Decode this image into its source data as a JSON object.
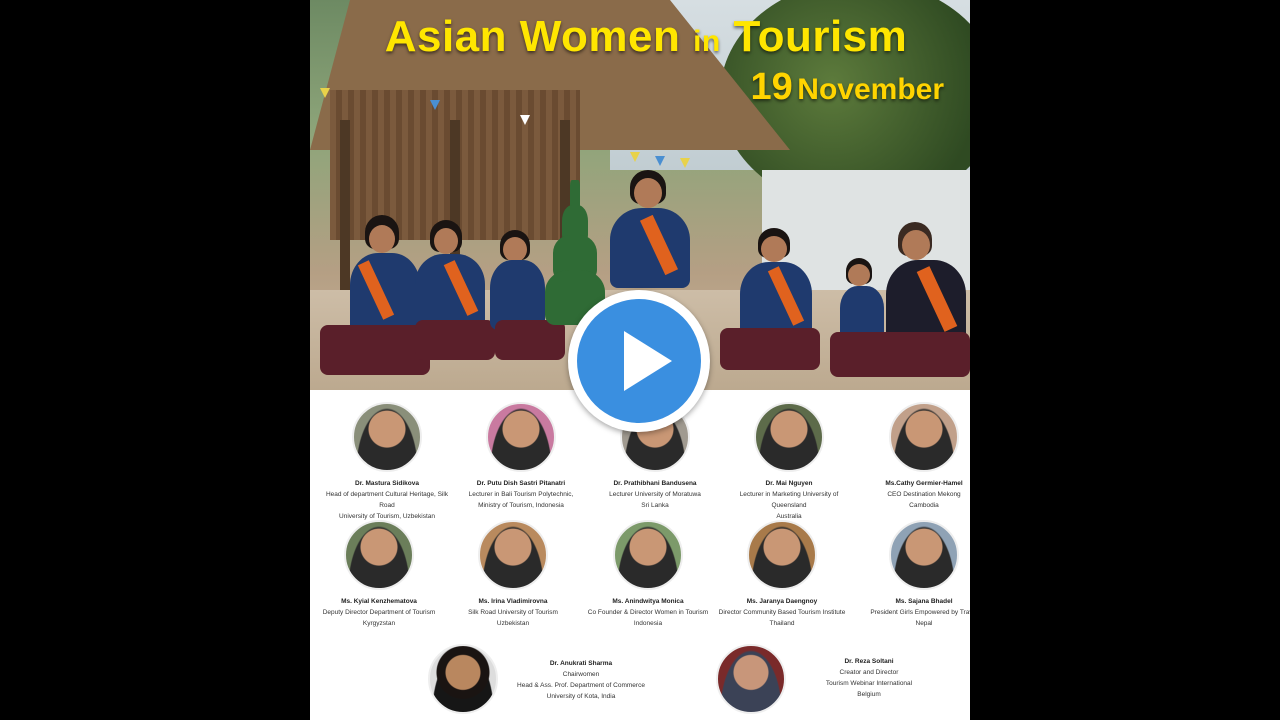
{
  "poster": {
    "title_main": "Asian Women",
    "title_in": "in",
    "title_tail": "Tourism",
    "date_day": "19",
    "date_month": "November"
  },
  "colors": {
    "title": "#ffe600",
    "play": "#3a8fe0",
    "background": "#000000"
  },
  "speakers_row1": [
    {
      "name": "Dr. Mastura Sidikova",
      "line1": "Head of department Cultural Heritage, Silk Road",
      "line2": "University of Tourism, Uzbekistan"
    },
    {
      "name": "Dr. Putu Dish Sastri Pitanatri",
      "line1": "Lecturer in Bali Tourism Polytechnic,",
      "line2": "Ministry of Tourism, Indonesia"
    },
    {
      "name": "Dr. Prathibhani Bandusena",
      "line1": "Lecturer University of Moratuwa",
      "line2": "Sri Lanka"
    },
    {
      "name": "Dr. Mai Nguyen",
      "line1": "Lecturer in Marketing University of Queensland",
      "line2": "Australia"
    },
    {
      "name": "Ms.Cathy Germier-Hamel",
      "line1": "CEO Destination Mekong",
      "line2": "Cambodia"
    }
  ],
  "speakers_row2": [
    {
      "name": "Ms. Kyial Kenzhematova",
      "line1": "Deputy Director Department of Tourism",
      "line2": "Kyrgyzstan"
    },
    {
      "name": "Ms. Irina Vladimirovna",
      "line1": "Silk Road University of Tourism",
      "line2": "Uzbekistan"
    },
    {
      "name": "Ms. Anindwitya Monica",
      "line1": "Co Founder & Director Women in Tourism",
      "line2": "Indonesia"
    },
    {
      "name": "Ms. Jaranya Daengnoy",
      "line1": "Director Community Based Tourism Institute",
      "line2": "Thailand"
    },
    {
      "name": "Ms. Sajana Bhadel",
      "line1": "President Girls Empowered by Travel",
      "line2": "Nepal"
    }
  ],
  "chair": {
    "name": "Dr. Anukrati Sharma",
    "role": "Chairwomen",
    "line1": "Head & Ass. Prof. Department of Commerce",
    "line2": "University of Kota, India"
  },
  "creator": {
    "name": "Dr. Reza Soltani",
    "role": "Creator and Director",
    "line1": "Tourism Webinar International",
    "line2": "Belgium"
  }
}
